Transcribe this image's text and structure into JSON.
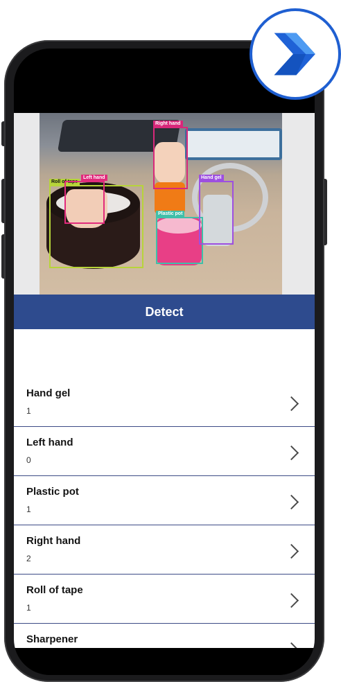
{
  "app": {
    "detect_button_label": "Detect",
    "photo_tags": {
      "roll_of_tape": "Roll of tape",
      "left_hand": "Left hand",
      "right_hand": "Right hand",
      "plastic_pot": "Plastic pot",
      "hand_gel": "Hand gel"
    },
    "results": [
      {
        "label": "Hand gel",
        "count": "1"
      },
      {
        "label": "Left hand",
        "count": "0"
      },
      {
        "label": "Plastic pot",
        "count": "1"
      },
      {
        "label": "Right hand",
        "count": "2"
      },
      {
        "label": "Roll of tape",
        "count": "1"
      },
      {
        "label": "Sharpener",
        "count": ""
      }
    ]
  },
  "colors": {
    "accent_blue": "#2e4b8e",
    "logo_blue": "#1f5fd1",
    "box_tape": "#b7d43a",
    "box_hands": "#e12b7c",
    "box_pot": "#3fbfa9",
    "box_gel": "#9d4fe0"
  },
  "icons": {
    "logo": "power-automate-logo-icon",
    "row_chevron": "chevron-right-icon"
  }
}
